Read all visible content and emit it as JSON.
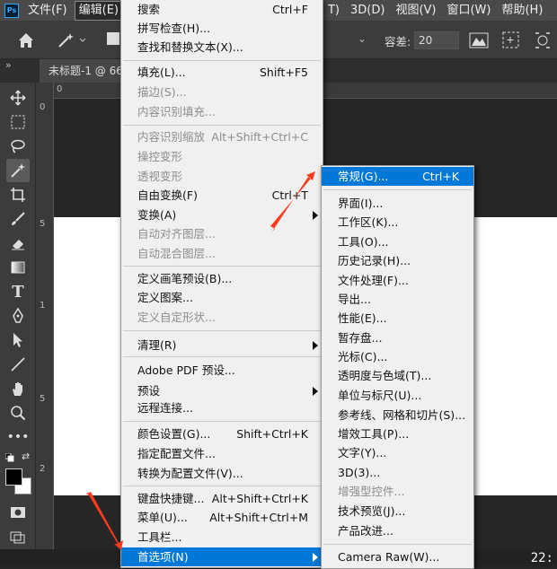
{
  "app": {
    "logo": "Ps"
  },
  "menubar": {
    "items": [
      "文件(F)",
      "编辑(E)",
      "T)",
      "3D(D)",
      "视图(V)",
      "窗口(W)",
      "帮助(H)"
    ]
  },
  "options": {
    "tolerance_label": "容差:",
    "tolerance_value": "20"
  },
  "document": {
    "tab_title": "未标题-1 @ 66"
  },
  "ruler": {
    "h0": "0",
    "v0": "0",
    "v5a": "5",
    "v1": "1",
    "v5b": "5",
    "v2": "2"
  },
  "edit_menu": {
    "items": [
      {
        "label": "搜索",
        "shortcut": "Ctrl+F",
        "disabled": false
      },
      {
        "label": "拼写检查(H)...",
        "shortcut": "",
        "disabled": false
      },
      {
        "label": "查找和替换文本(X)...",
        "shortcut": "",
        "disabled": false
      },
      {
        "label": "填充(L)...",
        "shortcut": "Shift+F5",
        "disabled": false
      },
      {
        "label": "描边(S)...",
        "shortcut": "",
        "disabled": true
      },
      {
        "label": "内容识别填充...",
        "shortcut": "",
        "disabled": true
      },
      {
        "label": "内容识别缩放",
        "shortcut": "Alt+Shift+Ctrl+C",
        "disabled": true
      },
      {
        "label": "操控变形",
        "shortcut": "",
        "disabled": true
      },
      {
        "label": "透视变形",
        "shortcut": "",
        "disabled": true
      },
      {
        "label": "自由变换(F)",
        "shortcut": "Ctrl+T",
        "disabled": false
      },
      {
        "label": "变换(A)",
        "shortcut": "",
        "disabled": false
      },
      {
        "label": "自动对齐图层...",
        "shortcut": "",
        "disabled": true
      },
      {
        "label": "自动混合图层...",
        "shortcut": "",
        "disabled": true
      },
      {
        "label": "定义画笔预设(B)...",
        "shortcut": "",
        "disabled": false
      },
      {
        "label": "定义图案...",
        "shortcut": "",
        "disabled": false
      },
      {
        "label": "定义自定形状...",
        "shortcut": "",
        "disabled": true
      },
      {
        "label": "清理(R)",
        "shortcut": "",
        "disabled": false
      },
      {
        "label": "Adobe PDF 预设...",
        "shortcut": "",
        "disabled": false
      },
      {
        "label": "预设",
        "shortcut": "",
        "disabled": false
      },
      {
        "label": "远程连接...",
        "shortcut": "",
        "disabled": false
      },
      {
        "label": "颜色设置(G)...",
        "shortcut": "Shift+Ctrl+K",
        "disabled": false
      },
      {
        "label": "指定配置文件...",
        "shortcut": "",
        "disabled": false
      },
      {
        "label": "转换为配置文件(V)...",
        "shortcut": "",
        "disabled": false
      },
      {
        "label": "键盘快捷键...",
        "shortcut": "Alt+Shift+Ctrl+K",
        "disabled": false
      },
      {
        "label": "菜单(U)...",
        "shortcut": "Alt+Shift+Ctrl+M",
        "disabled": false
      },
      {
        "label": "工具栏...",
        "shortcut": "",
        "disabled": false
      },
      {
        "label": "首选项(N)",
        "shortcut": "",
        "disabled": false
      }
    ]
  },
  "prefs_submenu": {
    "items": [
      {
        "label": "常规(G)...",
        "shortcut": "Ctrl+K",
        "disabled": false
      },
      {
        "label": "界面(I)...",
        "shortcut": "",
        "disabled": false
      },
      {
        "label": "工作区(K)...",
        "shortcut": "",
        "disabled": false
      },
      {
        "label": "工具(O)...",
        "shortcut": "",
        "disabled": false
      },
      {
        "label": "历史记录(H)...",
        "shortcut": "",
        "disabled": false
      },
      {
        "label": "文件处理(F)...",
        "shortcut": "",
        "disabled": false
      },
      {
        "label": "导出...",
        "shortcut": "",
        "disabled": false
      },
      {
        "label": "性能(E)...",
        "shortcut": "",
        "disabled": false
      },
      {
        "label": "暂存盘...",
        "shortcut": "",
        "disabled": false
      },
      {
        "label": "光标(C)...",
        "shortcut": "",
        "disabled": false
      },
      {
        "label": "透明度与色域(T)...",
        "shortcut": "",
        "disabled": false
      },
      {
        "label": "单位与标尺(U)...",
        "shortcut": "",
        "disabled": false
      },
      {
        "label": "参考线、网格和切片(S)...",
        "shortcut": "",
        "disabled": false
      },
      {
        "label": "增效工具(P)...",
        "shortcut": "",
        "disabled": false
      },
      {
        "label": "文字(Y)...",
        "shortcut": "",
        "disabled": false
      },
      {
        "label": "3D(3)...",
        "shortcut": "",
        "disabled": false
      },
      {
        "label": "增强型控件...",
        "shortcut": "",
        "disabled": true
      },
      {
        "label": "技术预览(J)...",
        "shortcut": "",
        "disabled": false
      },
      {
        "label": "产品改进...",
        "shortcut": "",
        "disabled": false
      },
      {
        "label": "Camera Raw(W)...",
        "shortcut": "",
        "disabled": false
      }
    ]
  },
  "clock": "22:",
  "colors": {
    "highlight": "#0078d7",
    "arrow": "#ff3b1f",
    "ps_blue": "#31a8ff"
  }
}
